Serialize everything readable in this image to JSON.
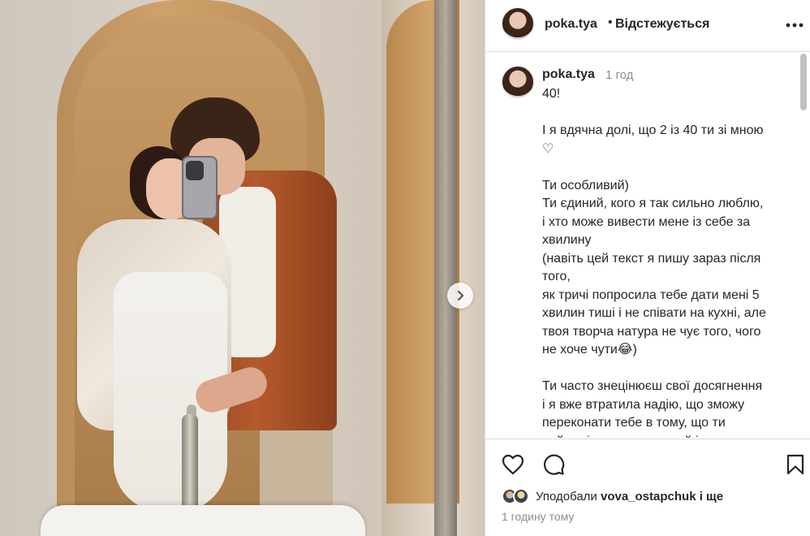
{
  "post": {
    "username": "poka.tya",
    "separator": "•",
    "follow_status": "Відстежується",
    "caption_time": "1 год",
    "caption_text": "40!\n\nІ я вдячна долі, що 2 із 40 ти зі мною\n♡\n\nТи особливий)\nТи єдиний, кого я так сильно люблю,\nі хто може вивести мене із себе за\nхвилину\n(навіть цей текст я пишу зараз після\nтого,\nяк тричі попросила тебе дати мені 5\nхвилин тиші і не співати на кухні, але\nтвоя творча натура не чує того, чого\nне хоче чути😂)\n\nТи часто знецінюєш свої досягнення\nі я вже втратила надію, що зможу\nпереконати тебе в тому, що ти\nнеймовірно талановитий і я пишаюсь тобі",
    "likes_prefix": "Уподобали",
    "likes_user": "vova_ostapchuk",
    "likes_suffix": "і ще",
    "posted_ago": "1 годину тому"
  },
  "icons": {
    "more": "more-horizontal-icon",
    "like": "heart-icon",
    "comment": "comment-icon",
    "save": "bookmark-icon",
    "next": "chevron-right-icon"
  },
  "colors": {
    "text": "#262626",
    "muted": "#8e8e8e",
    "border": "#dbdbdb"
  }
}
